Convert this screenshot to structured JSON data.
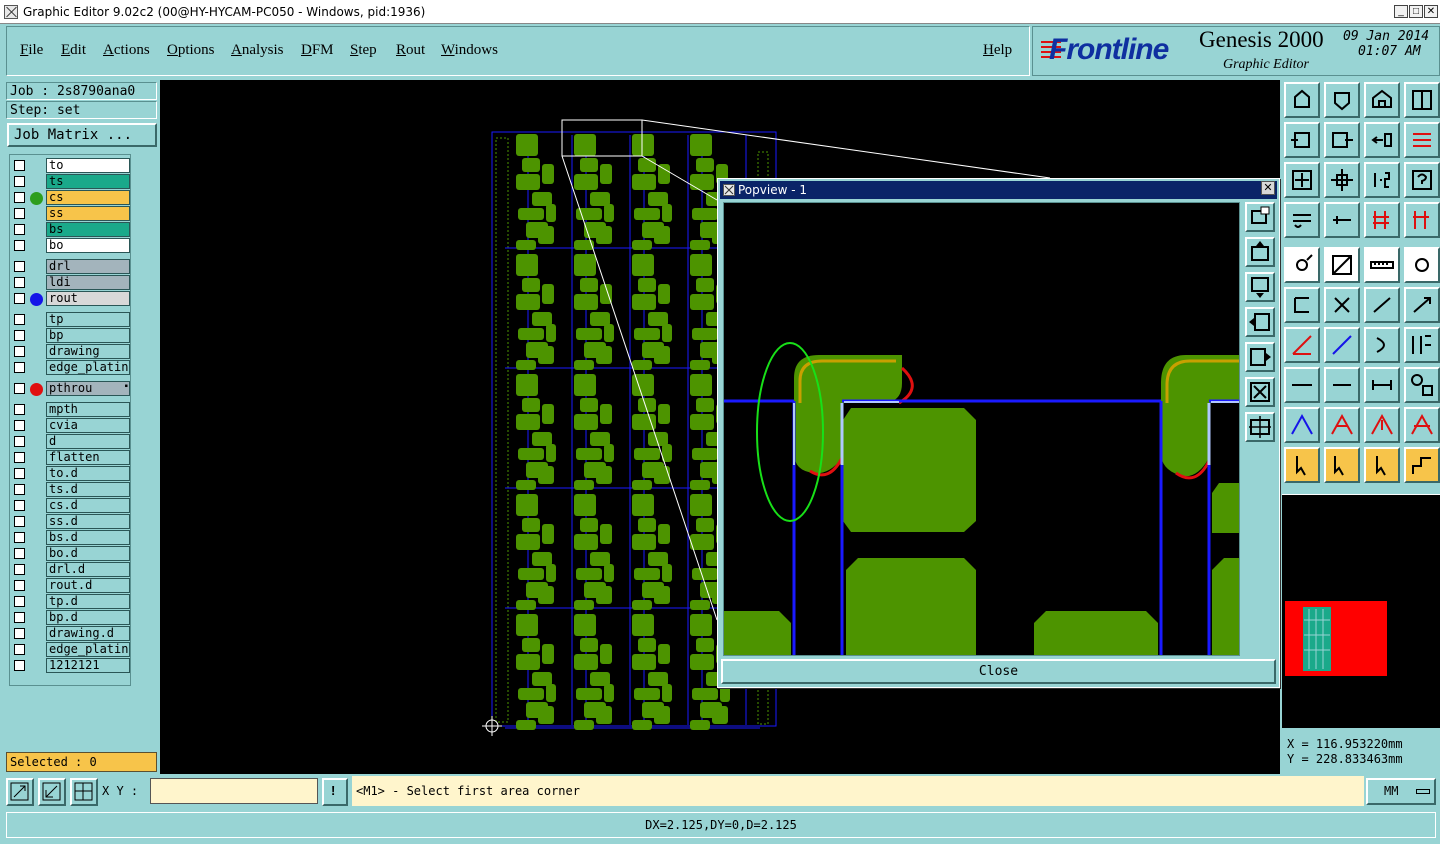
{
  "window": {
    "title": "Graphic Editor 9.02c2 (00@HY-HYCAM-PC050 - Windows, pid:1936)",
    "min_label": "_",
    "max_label": "□",
    "close_label": "✕"
  },
  "menu": {
    "items": [
      "File",
      "Edit",
      "Actions",
      "Options",
      "Analysis",
      "DFM",
      "Step",
      "Rout",
      "Windows"
    ],
    "help": "Help"
  },
  "brand": {
    "logo": "Frontline",
    "product": "Genesis 2000",
    "module": "Graphic Editor",
    "date": "09 Jan 2014",
    "time": "01:07 AM"
  },
  "job": {
    "job_label": "Job : 2s8790ana0",
    "step_label": "Step: set",
    "matrix_button": "Job Matrix ..."
  },
  "layers": [
    {
      "name": "to",
      "color": "#ffffff"
    },
    {
      "name": "ts",
      "color": "#1aa98a"
    },
    {
      "name": "cs",
      "color": "#f7c44a",
      "indicator": "#2e9e1e"
    },
    {
      "name": "ss",
      "color": "#f7c44a"
    },
    {
      "name": "bs",
      "color": "#1aa98a"
    },
    {
      "name": "bo",
      "color": "#ffffff"
    },
    {
      "name": "drl",
      "color": "#a3b4bc"
    },
    {
      "name": "ldi",
      "color": "#a3b4bc"
    },
    {
      "name": "rout",
      "color": "#d8d8d8",
      "indicator": "#1515e8"
    },
    {
      "name": "tp",
      "color": "#98d4d4"
    },
    {
      "name": "bp",
      "color": "#98d4d4"
    },
    {
      "name": "drawing",
      "color": "#98d4d4"
    },
    {
      "name": "edge_plating",
      "color": "#98d4d4"
    },
    {
      "name": "pthrou",
      "color": "#a3b4bc",
      "indicator": "#e01010",
      "marker": "▪"
    },
    {
      "name": "mpth",
      "color": "#98d4d4"
    },
    {
      "name": "cvia",
      "color": "#98d4d4"
    },
    {
      "name": "d",
      "color": "#98d4d4"
    },
    {
      "name": "flatten",
      "color": "#98d4d4"
    },
    {
      "name": "to.d",
      "color": "#98d4d4"
    },
    {
      "name": "ts.d",
      "color": "#98d4d4"
    },
    {
      "name": "cs.d",
      "color": "#98d4d4"
    },
    {
      "name": "ss.d",
      "color": "#98d4d4"
    },
    {
      "name": "bs.d",
      "color": "#98d4d4"
    },
    {
      "name": "bo.d",
      "color": "#98d4d4"
    },
    {
      "name": "drl.d",
      "color": "#98d4d4"
    },
    {
      "name": "rout.d",
      "color": "#98d4d4"
    },
    {
      "name": "tp.d",
      "color": "#98d4d4"
    },
    {
      "name": "bp.d",
      "color": "#98d4d4"
    },
    {
      "name": "drawing.d",
      "color": "#98d4d4"
    },
    {
      "name": "edge_plating.d",
      "color": "#98d4d4"
    },
    {
      "name": "1212121",
      "color": "#98d4d4"
    }
  ],
  "selected_label": "Selected : 0",
  "popview": {
    "title": "Popview - 1",
    "close_button": "Close"
  },
  "coords": {
    "x": "X = 116.953220mm",
    "y": "Y = 228.833463mm"
  },
  "status": {
    "xy_label": "X Y :",
    "xy_value": "",
    "prompt": "<M1> - Select first area corner",
    "units": "MM",
    "measure": "DX=2.125,DY=0,D=2.125",
    "info_button": "!"
  },
  "colors": {
    "panel": "#98d4d4",
    "copper": "#4d9400",
    "rout": "#1a1aff",
    "highlight": "#f7c44a"
  }
}
